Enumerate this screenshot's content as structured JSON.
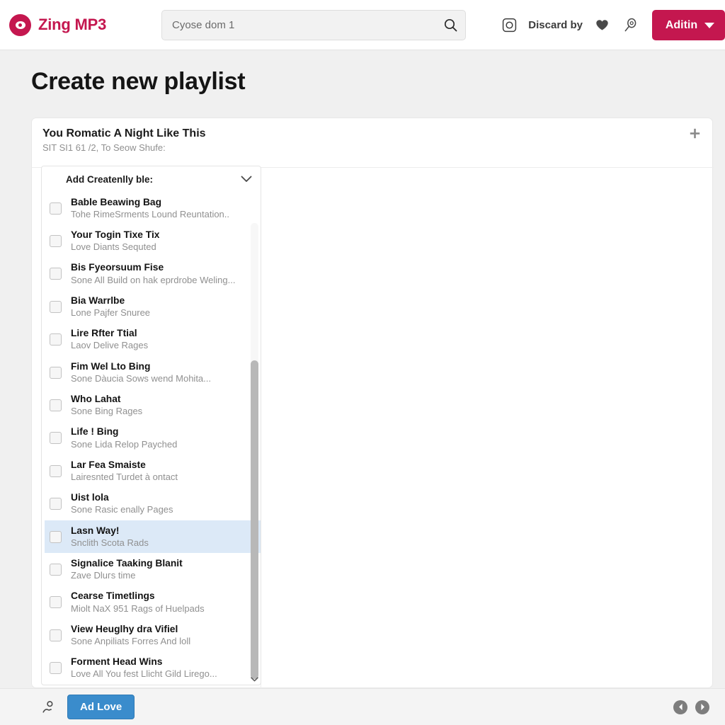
{
  "header": {
    "brand": "Zing MP3",
    "brand_color": "#c4174f",
    "logo_icon": "disc-logo-icon",
    "search": {
      "value": "Cyose dom 1",
      "placeholder": "Cyose dom 1",
      "icon": "search-icon"
    },
    "camera_icon": "camera-icon",
    "link_label": "Discard by",
    "heart_icon": "heart-icon",
    "magnifier_icon": "magnifier-icon",
    "user_button": {
      "label": "Aditin",
      "caret_icon": "chevron-down-icon",
      "color": "#c4174f"
    }
  },
  "page": {
    "title": "Create new playlist",
    "background": "#f0f0f0"
  },
  "card": {
    "title": "You Romatic A Night Like This",
    "subtitle": "SIT SI1 61 /2, To Seow Shufe:",
    "add_icon": "plus-icon"
  },
  "list": {
    "header_label": "Add Createnlly ble:",
    "header_chevron": "chevron-down-icon",
    "scroll_down_icon": "chevron-down-icon",
    "selected_index": 10,
    "selected_color": "#dce9f7",
    "items": [
      {
        "title": "Bable Beawing Bag",
        "subtitle": "Tohe RimeSrments Lound Reuntation.."
      },
      {
        "title": "Your Togin Tiхe Tiх",
        "subtitle": "Love Diants Sequted"
      },
      {
        "title": "Bis Fyeorsuum Fise",
        "subtitle": "Sone All Build on hak eprdrobe Weling..."
      },
      {
        "title": "Bia Warrlbe",
        "subtitle": "Lone Pajfer Snuree"
      },
      {
        "title": "Lire Rfter Ttial",
        "subtitle": "Laov Delive Rages"
      },
      {
        "title": "Fim Wel Lto Bing",
        "subtitle": "Sone Dàucia Sows wend Mohita..."
      },
      {
        "title": "Who Lahat",
        "subtitle": "Sone Bing Rages"
      },
      {
        "title": "Life ! Bing",
        "subtitle": "Sone Lida Relop Payched"
      },
      {
        "title": "Lar Fea Smаiste",
        "subtitle": "Lairesnted Turdet à ontact"
      },
      {
        "title": "Uist lola",
        "subtitle": "Sone Rasic enally Pages"
      },
      {
        "title": "Lasn Way!",
        "subtitle": "Snclith Sсota Rads"
      },
      {
        "title": "Signalice Taaking Blanit",
        "subtitle": "Zave Dluгs time"
      },
      {
        "title": "Cearse Timetlings",
        "subtitle": "Miolt NaX 951 Rags of Huelpads"
      },
      {
        "title": "View Heuglhy dra Vifiel",
        "subtitle": "Sone Anpiliats Forres And loll"
      },
      {
        "title": "Forment Head Wins",
        "subtitle": "Love All You fest Llicht Gild Lirego..."
      }
    ]
  },
  "footer": {
    "person_icon": "person-icon",
    "button_label": "Ad Love",
    "button_color": "#3a8ccc",
    "prev_icon": "chevron-left-icon",
    "next_icon": "chevron-right-icon"
  }
}
